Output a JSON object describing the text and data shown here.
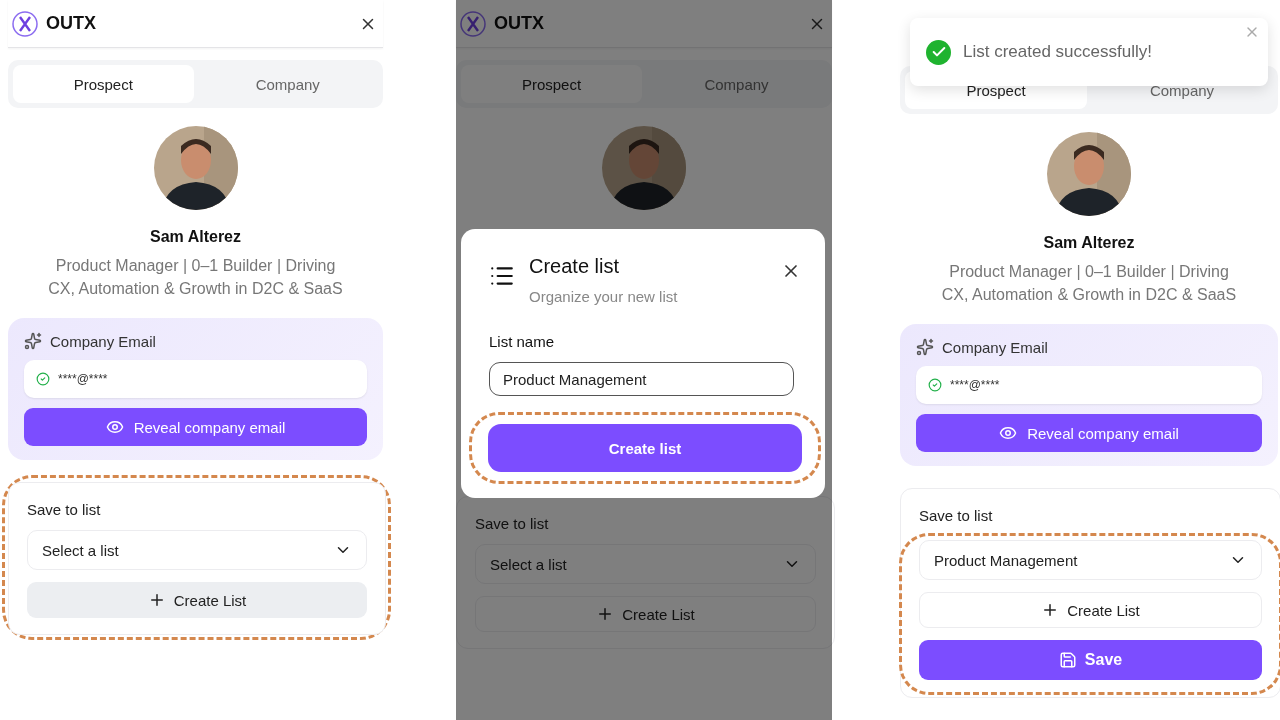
{
  "panels": [
    {
      "header": {
        "brand": "OUTX"
      },
      "tabs": [
        {
          "label": "Prospect",
          "selected": true
        },
        {
          "label": "Company",
          "selected": false
        }
      ],
      "profile": {
        "name": "Sam Alterez",
        "headline": "Product Manager | 0–1 Builder | Driving CX, Automation & Growth in D2C & SaaS"
      },
      "email_card": {
        "title": "Company Email",
        "masked_email": "****@****",
        "button": "Reveal company email"
      },
      "save_list": {
        "label": "Save to list",
        "highlighted": true,
        "controls_highlighted": false,
        "select": {
          "placeholder": "Select a list"
        },
        "buttons": [
          {
            "kind": "create-muted",
            "label": "Create List"
          }
        ]
      },
      "dimmed": false
    },
    {
      "header": {
        "brand": "OUTX"
      },
      "tabs": [
        {
          "label": "Prospect",
          "selected": true
        },
        {
          "label": "Company",
          "selected": false
        }
      ],
      "save_list": {
        "label": "Save to list",
        "highlighted": false,
        "controls_highlighted": false,
        "select": {
          "placeholder": "Select a list"
        },
        "buttons": [
          {
            "kind": "create",
            "label": "Create List"
          }
        ]
      },
      "dimmed": true,
      "modal": {
        "title": "Create list",
        "subtitle": "Organize your new list",
        "field_label": "List name",
        "field_value": "Product Management",
        "button": "Create list",
        "button_highlighted": true
      }
    },
    {
      "toast": {
        "message": "List created successfully!"
      },
      "tabs": [
        {
          "label": "Prospect",
          "selected": true
        },
        {
          "label": "Company",
          "selected": false
        }
      ],
      "profile": {
        "name": "Sam Alterez",
        "headline": "Product Manager | 0–1 Builder | Driving CX, Automation & Growth in D2C & SaaS"
      },
      "email_card": {
        "title": "Company Email",
        "masked_email": "****@****",
        "button": "Reveal company email"
      },
      "save_list": {
        "label": "Save to list",
        "highlighted": false,
        "controls_highlighted": true,
        "select": {
          "value": "Product Management"
        },
        "buttons": [
          {
            "kind": "create",
            "label": "Create List"
          },
          {
            "kind": "save",
            "label": "Save"
          }
        ]
      },
      "dimmed": false
    }
  ]
}
